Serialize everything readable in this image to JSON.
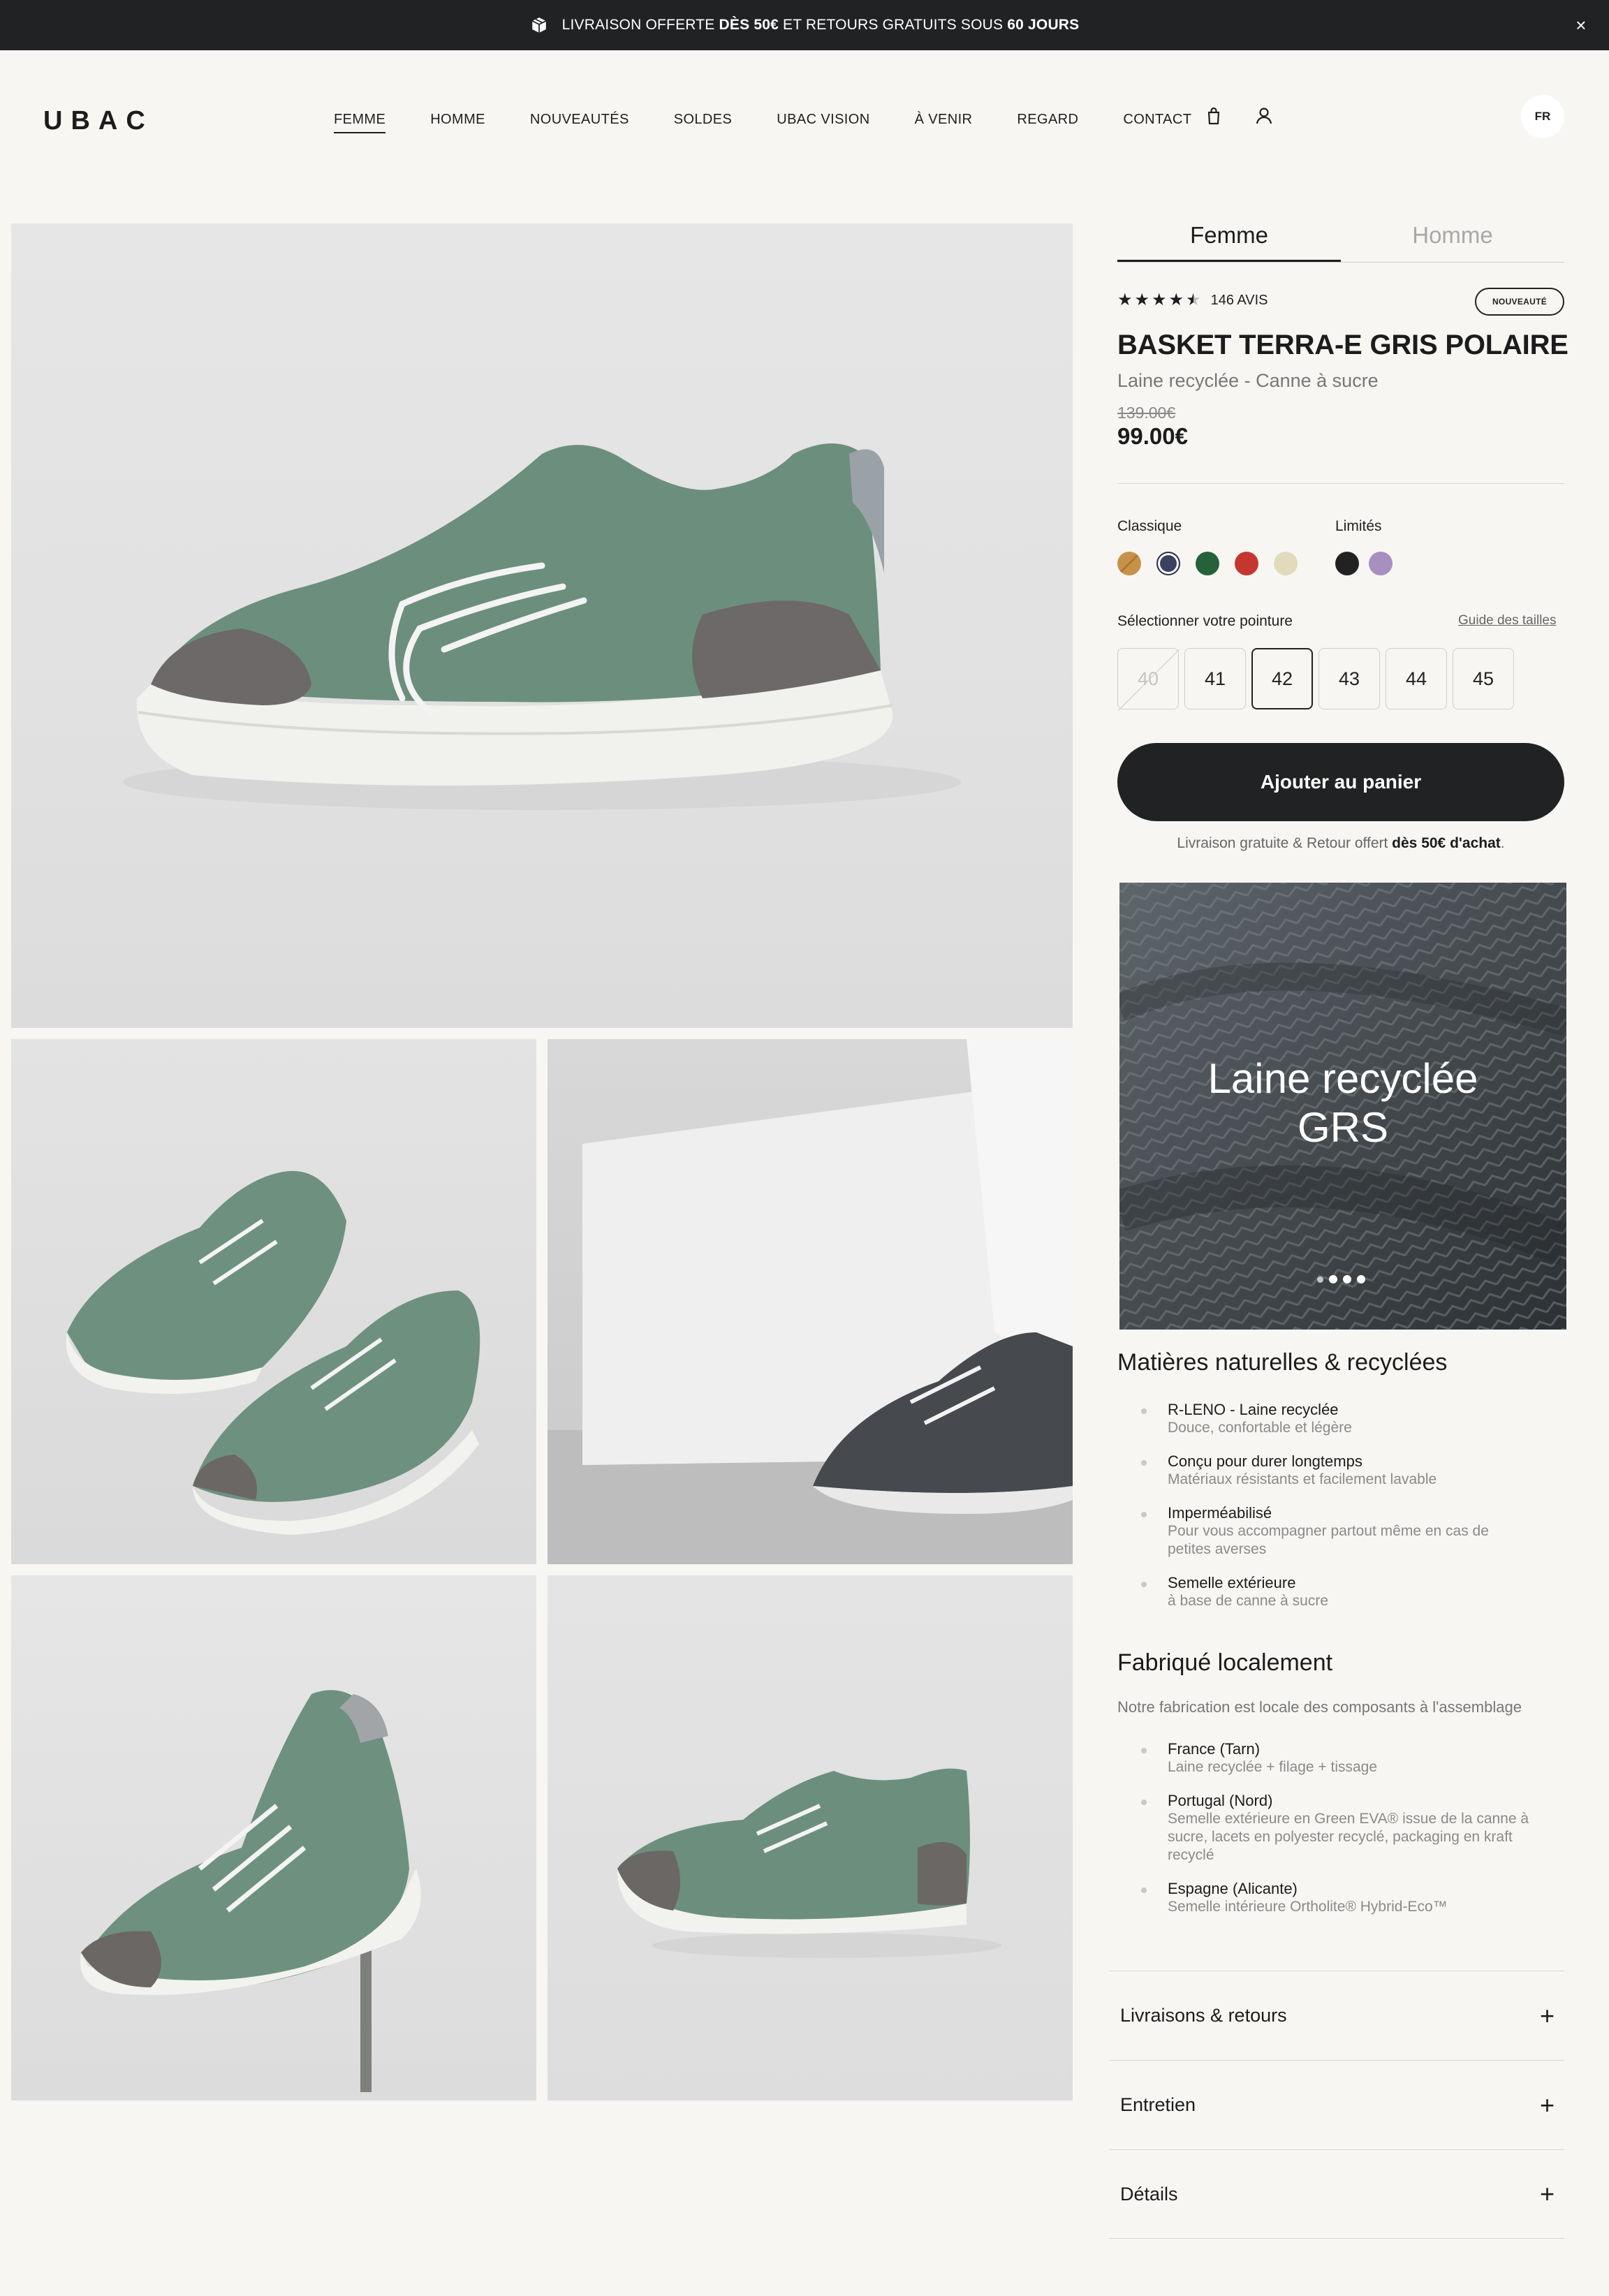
{
  "announcement": {
    "part1": "LIVRAISON OFFERTE ",
    "bold1": "DÈS 50€",
    "part2": " ET RETOURS GRATUITS SOUS ",
    "bold2": "60 JOURS",
    "close": "×"
  },
  "header": {
    "logo": "UBAC",
    "nav": [
      "FEMME",
      "HOMME",
      "NOUVEAUTÉS",
      "SOLDES",
      "UBAC VISION",
      "À VENIR",
      "REGARD",
      "CONTACT"
    ],
    "active_nav": "FEMME",
    "lang": "FR"
  },
  "product": {
    "tabs": [
      "Femme",
      "Homme"
    ],
    "active_tab": "Femme",
    "rating_stars": 4.5,
    "reviews": "146 AVIS",
    "badge": "NOUVEAUTÉ",
    "title": "BASKET TERRA-E GRIS POLAIRE",
    "subtitle": "Laine recyclée - Canne à sucre",
    "old_price": "139.00€",
    "price": "99.00€"
  },
  "colors": {
    "classic_label": "Classique",
    "limited_label": "Limités",
    "classic": [
      "#c8914a",
      "#3a4262",
      "#27613a",
      "#c53631",
      "#e1dbbb"
    ],
    "limited": [
      "#222222",
      "#a78fc0"
    ],
    "selected_index": 1
  },
  "sizes": {
    "label": "Sélectionner votre pointure",
    "guide": "Guide des tailles",
    "options": [
      "40",
      "41",
      "42",
      "43",
      "44",
      "45"
    ],
    "unavailable": [
      "40"
    ],
    "selected": "42"
  },
  "cart": {
    "button": "Ajouter au panier",
    "note_part1": "Livraison gratuite & Retour offert ",
    "note_bold": "dès 50€ d'achat",
    "note_end": "."
  },
  "material_card": {
    "line1": "Laine recyclée",
    "line2": "GRS"
  },
  "materials": {
    "title": "Matières naturelles & recyclées",
    "items": [
      {
        "head": "R-LENO - Laine recyclée",
        "text": "Douce, confortable et légère"
      },
      {
        "head": "Conçu pour durer longtemps",
        "text": "Matériaux résistants et facilement lavable"
      },
      {
        "head": "Imperméabilisé",
        "text": "Pour vous accompagner partout même en cas de petites averses"
      },
      {
        "head": "Semelle extérieure",
        "text": "à base de canne à sucre"
      }
    ]
  },
  "local": {
    "title": "Fabriqué localement",
    "intro": "Notre fabrication est locale des composants à l'assemblage",
    "items": [
      {
        "head": "France (Tarn)",
        "text": "Laine recyclée + filage + tissage"
      },
      {
        "head": "Portugal (Nord)",
        "text": "Semelle extérieure en Green EVA® issue de la canne à sucre, lacets en polyester recyclé, packaging en kraft recyclé"
      },
      {
        "head": "Espagne (Alicante)",
        "text": "Semelle intérieure Ortholite® Hybrid-Eco™"
      }
    ]
  },
  "accordion": [
    "Livraisons & retours",
    "Entretien",
    "Détails"
  ],
  "accordion_icon": "+"
}
